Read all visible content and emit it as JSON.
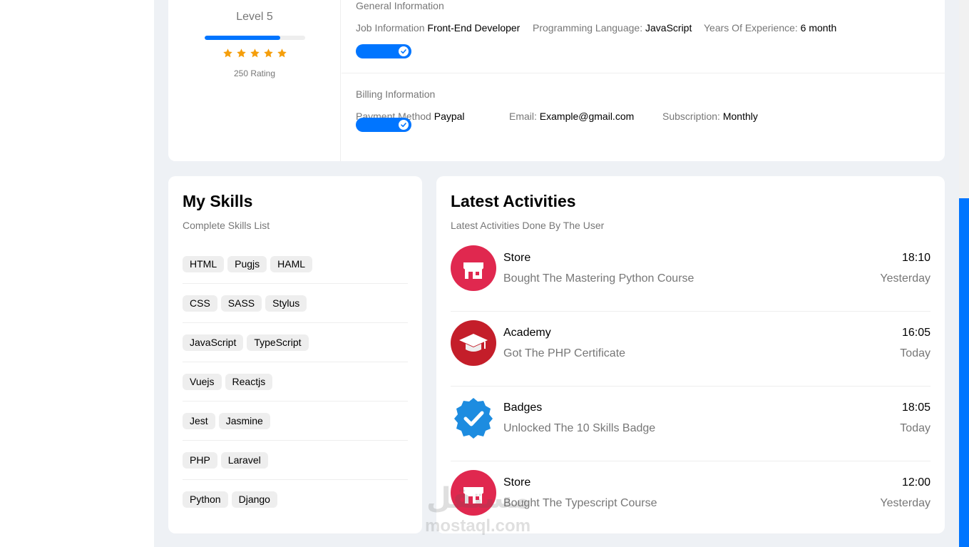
{
  "profile": {
    "level": "Level 5",
    "level_progress": 0.75,
    "stars": 5,
    "rating": "250 Rating"
  },
  "general": {
    "title": "General Information",
    "items": [
      {
        "label": "Job Information",
        "value": "Front-End Developer"
      },
      {
        "label": "Programming Language:",
        "value": "JavaScript"
      },
      {
        "label": "Years Of Experience:",
        "value": "6 month"
      }
    ],
    "toggle_on": true
  },
  "billing": {
    "title": "Billing Information",
    "items": [
      {
        "label": "Payment Method",
        "value": "Paypal"
      },
      {
        "label": "Email:",
        "value": "Example@gmail.com"
      },
      {
        "label": "Subscription:",
        "value": "Monthly"
      }
    ],
    "toggle_on": true
  },
  "skills": {
    "title": "My Skills",
    "subtitle": "Complete Skills List",
    "rows": [
      [
        "HTML",
        "Pugjs",
        "HAML"
      ],
      [
        "CSS",
        "SASS",
        "Stylus"
      ],
      [
        "JavaScript",
        "TypeScript"
      ],
      [
        "Vuejs",
        "Reactjs"
      ],
      [
        "Jest",
        "Jasmine"
      ],
      [
        "PHP",
        "Laravel"
      ],
      [
        "Python",
        "Django"
      ]
    ]
  },
  "activities": {
    "title": "Latest Activities",
    "subtitle": "Latest Activities Done By The User",
    "items": [
      {
        "name": "Store",
        "desc": "Bought The Mastering Python Course",
        "time": "18:10",
        "day": "Yesterday",
        "icon": "store-icon"
      },
      {
        "name": "Academy",
        "desc": "Got The PHP Certificate",
        "time": "16:05",
        "day": "Today",
        "icon": "graduation-cap-icon"
      },
      {
        "name": "Badges",
        "desc": "Unlocked The 10 Skills Badge",
        "time": "18:05",
        "day": "Today",
        "icon": "verified-badge-icon"
      },
      {
        "name": "Store",
        "desc": "Bought The Typescript Course",
        "time": "12:00",
        "day": "Yesterday",
        "icon": "store-icon"
      }
    ]
  },
  "watermark": {
    "logo": "مستقل",
    "text": "mostaql.com"
  },
  "colors": {
    "accent": "#0075ff",
    "star": "#f59e0b",
    "store": "#e0284f",
    "academy": "#c41e2a",
    "badge": "#1d8ce0"
  }
}
